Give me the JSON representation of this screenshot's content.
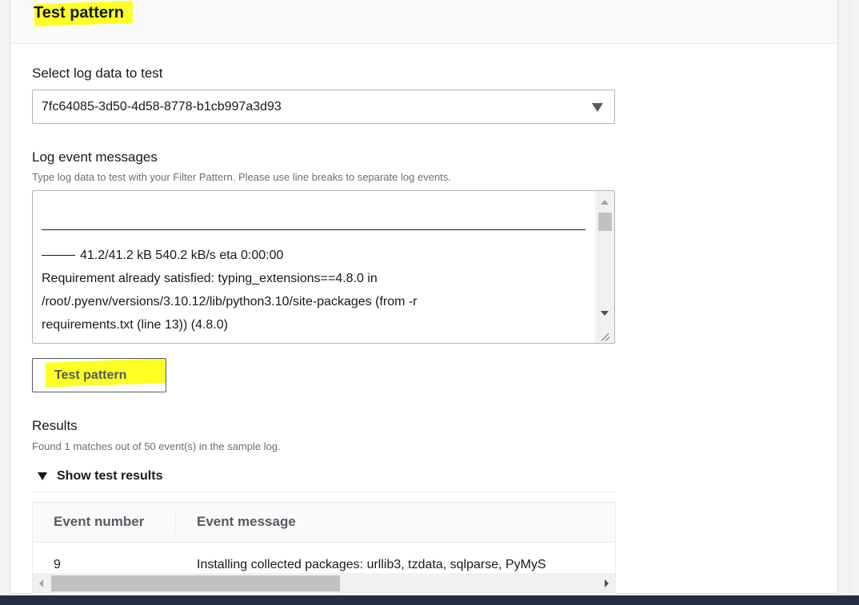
{
  "panel": {
    "title": "Test pattern"
  },
  "select_log": {
    "label": "Select log data to test",
    "value": "7fc64085-3d50-4d58-8778-b1cb997a3d93"
  },
  "log_events": {
    "label": "Log event messages",
    "description": "Type log data to test with your Filter Pattern. Please use line breaks to separate log events.",
    "lines": [
      "41.2/41.2 kB 540.2 kB/s eta 0:00:00",
      "Requirement already satisfied: typing_extensions==4.8.0 in",
      "/root/.pyenv/versions/3.10.12/lib/python3.10/site-packages (from -r",
      "requirements.txt (line 13)) (4.8.0)"
    ]
  },
  "test_button": {
    "label": "Test pattern"
  },
  "results": {
    "label": "Results",
    "summary": "Found 1 matches out of 50 event(s) in the sample log.",
    "toggle_label": "Show test results",
    "columns": [
      "Event number",
      "Event message"
    ],
    "rows": [
      {
        "event_number": "9",
        "event_message": "Installing collected packages: urllib3, tzdata, sqlparse, PyMyS"
      }
    ]
  },
  "highlight_color": "#ffff00",
  "icons": {
    "select_caret": "caret-down-icon",
    "expander_caret": "caret-down-icon",
    "resize_grip": "resize-grip-icon"
  }
}
